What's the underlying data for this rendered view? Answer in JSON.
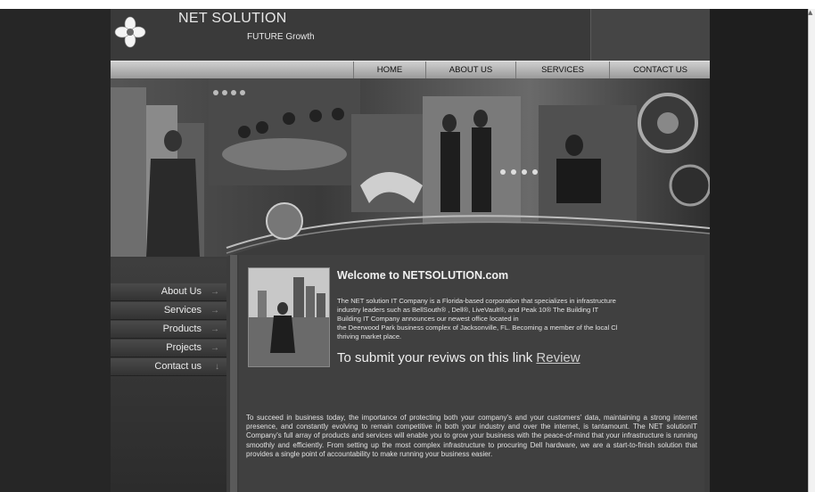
{
  "header": {
    "title": "NET SOLUTION",
    "tagline": "FUTURE Growth"
  },
  "nav": [
    {
      "label": "HOME"
    },
    {
      "label": "ABOUT US"
    },
    {
      "label": "SERVICES"
    },
    {
      "label": "CONTACT US"
    }
  ],
  "sidebar": [
    {
      "label": "About Us"
    },
    {
      "label": "Services"
    },
    {
      "label": "Products"
    },
    {
      "label": "Projects"
    },
    {
      "label": "Contact us"
    }
  ],
  "content": {
    "welcome": "Welcome to NETSOLUTION.com",
    "intro": "The NET solution IT Company is a Florida-based corporation that specializes in infrastructure \nindustry leaders such as BellSouth® , Dell®, LiveVault®, and Peak 10® The Building IT \nBuilding IT Company announces our newest office located in\nthe Deerwood Park business complex of Jacksonville, FL. Becoming a member of the local Cl\nthriving market place.",
    "review_prefix": "To submit your reviws on this link",
    "review_link": "Review",
    "body": "To succeed in business today, the importance of protecting both your company's and your customers' data, maintaining a strong internet presence, and constantly evolving to remain competitive in both your industry and over the internet, is tantamount. The NET solutionIT Company's full array of products and services will enable you to grow your business with the peace-of-mind that your infrastructure is running smoothly and efficiently. From setting up the most complex infrastructure to procuring Dell hardware, we are a start-to-finish solution that provides a single point of accountability to make running your business easier."
  },
  "colors": {
    "page_bg": "#3c3c3c",
    "outer_bg": "#262626",
    "nav_bg": "#b8b8b8",
    "text": "#e8e8e8"
  },
  "icons": {
    "logo": "flower-logo-icon",
    "side_arrow": "arrow-right-icon",
    "side_arrow_down": "arrow-down-icon"
  }
}
